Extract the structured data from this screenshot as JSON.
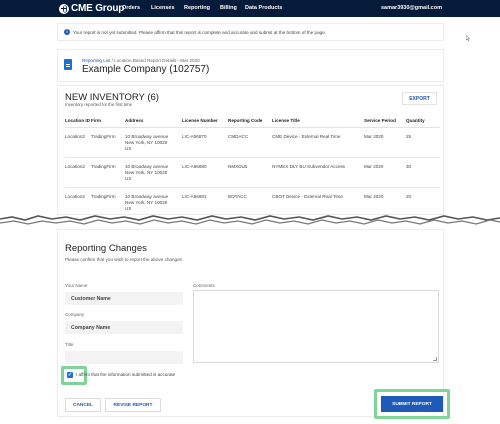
{
  "nav": {
    "logo": "CME Group",
    "items": [
      "Orders",
      "Licenses",
      "Reporting",
      "Billing",
      "Data Products"
    ],
    "user_email": "samar3930@gmail.com"
  },
  "alert": {
    "icon": "info-icon",
    "text": "Your report is not yet submitted. Please affirm that this report is complete and accurate and submit at the bottom of the page."
  },
  "header": {
    "breadcrumb_link": "Reporting List",
    "breadcrumb_rest": " / Location Based Report Details - Mar 2020",
    "title": "Example Company (102757)"
  },
  "inventory": {
    "title": "NEW INVENTORY (6)",
    "subtitle": "Inventory reported for the first time",
    "export_label": "EXPORT",
    "columns": [
      "Location ID",
      "Firm",
      "Address",
      "License Number",
      "Reporting Code",
      "License Title",
      "Service Period",
      "Quantity"
    ],
    "rows": [
      {
        "location": "Location2",
        "firm": "TradingFirm",
        "address": [
          "10 Broadway avenue",
          "New York, NY 10020",
          "US"
        ],
        "license_number": "LIC-A56870",
        "code": "CMDACC",
        "title": "CME Device - External Real Time",
        "period": "Mar 2020",
        "qty": "25"
      },
      {
        "location": "Location2",
        "firm": "TradingFirm",
        "address": [
          "10 Broadway avenue",
          "New York, NY 10020",
          "US"
        ],
        "license_number": "LIC-A56880",
        "code": "NMXDLB",
        "title": "NYMEX DLY BU Subvendor Access",
        "period": "Mar 2020",
        "qty": "30"
      },
      {
        "location": "Location2",
        "firm": "TradingFirm",
        "address": [
          "10 Broadway avenue",
          "New York, NY 10020",
          "US"
        ],
        "license_number": "LIC-A56881",
        "code": "BOTACC",
        "title": "CBOT Device - External Real Time",
        "period": "Mar 2020",
        "qty": "20"
      }
    ]
  },
  "reporting_changes": {
    "title": "Reporting Changes",
    "subtitle": "Please confirm that you wish to report the above changes",
    "your_name_label": "Your Name",
    "your_name_value": "Customer Name",
    "company_label": "Company",
    "company_value": "Company Name",
    "title_label": "Title",
    "title_value": "",
    "comments_label": "Comments",
    "affirm_text": "I affirm that the information submitted is accurate",
    "cancel_label": "CANCEL",
    "revise_label": "REVISE REPORT",
    "submit_label": "SUBMIT REPORT"
  },
  "colors": {
    "nav_bg": "#061b3a",
    "accent": "#1e5bb8",
    "highlight": "#7fd49a"
  }
}
